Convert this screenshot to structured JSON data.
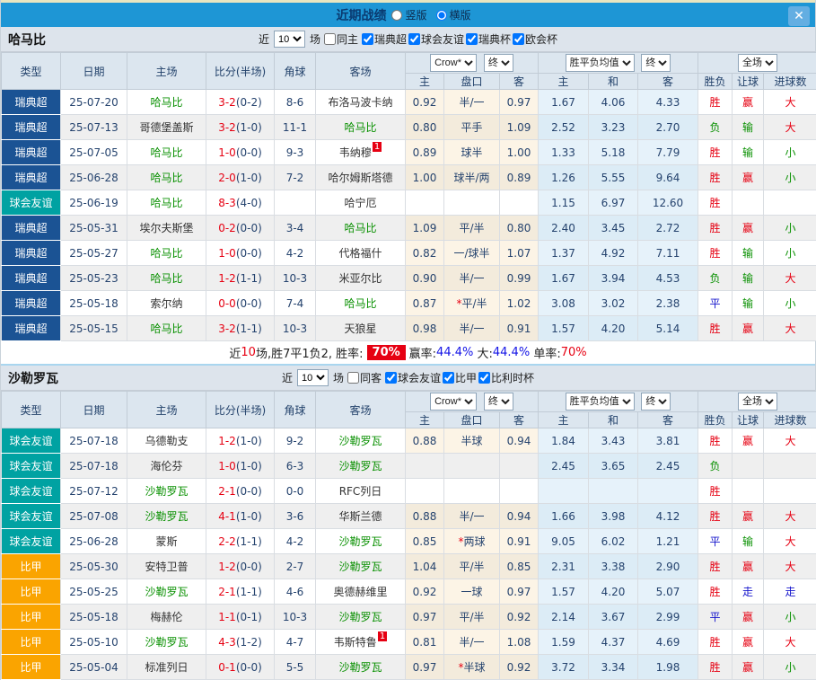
{
  "titlebar": {
    "title": "近期战绩",
    "radio_vertical": "竖版",
    "radio_horizontal": "横版",
    "close": "✕"
  },
  "columns": {
    "type": "类型",
    "date": "日期",
    "home": "主场",
    "score": "比分(半场)",
    "corner": "角球",
    "away": "客场",
    "h_home": "主",
    "h_handicap": "盘口",
    "h_away": "客",
    "m_home": "主",
    "m_draw": "和",
    "m_away": "客",
    "r_result": "胜负",
    "r_handicap": "让球",
    "r_goals": "进球数"
  },
  "selects": {
    "crow": "Crow*",
    "final1": "终",
    "mean": "胜平负均值",
    "final2": "终",
    "fullmatch": "全场"
  },
  "filter_words": {
    "near": "近",
    "games": "场"
  },
  "type_colors": {
    "瑞典超": "#1b5394",
    "球会友谊": "#00a2a2",
    "比甲": "#faa400"
  },
  "sections": [
    {
      "team": "哈马比",
      "filter": {
        "count": "10",
        "same": "同主",
        "leagues": [
          "瑞典超",
          "球会友谊",
          "瑞典杯",
          "欧会杯"
        ]
      },
      "rows": [
        {
          "type": "瑞典超",
          "date": "25-07-20",
          "home": "哈马比",
          "home_hl": true,
          "score": "3-2",
          "half": "(0-2)",
          "corner": "8-6",
          "away": "布洛马波卡纳",
          "away_hl": false,
          "odds": [
            "0.92",
            "半/一",
            "0.97"
          ],
          "mean": [
            "1.67",
            "4.06",
            "4.33"
          ],
          "res": [
            "胜",
            "赢",
            "大"
          ]
        },
        {
          "type": "瑞典超",
          "date": "25-07-13",
          "home": "哥德堡盖斯",
          "home_hl": false,
          "score": "3-2",
          "half": "(1-0)",
          "corner": "11-1",
          "away": "哈马比",
          "away_hl": true,
          "odds": [
            "0.80",
            "平手",
            "1.09"
          ],
          "mean": [
            "2.52",
            "3.23",
            "2.70"
          ],
          "res": [
            "负",
            "输",
            "大"
          ]
        },
        {
          "type": "瑞典超",
          "date": "25-07-05",
          "home": "哈马比",
          "home_hl": true,
          "score": "1-0",
          "half": "(0-0)",
          "corner": "9-3",
          "away": "韦纳穆",
          "away_hl": false,
          "away_badge": "1",
          "odds": [
            "0.89",
            "球半",
            "1.00"
          ],
          "mean": [
            "1.33",
            "5.18",
            "7.79"
          ],
          "res": [
            "胜",
            "输",
            "小"
          ]
        },
        {
          "type": "瑞典超",
          "date": "25-06-28",
          "home": "哈马比",
          "home_hl": true,
          "score": "2-0",
          "half": "(1-0)",
          "corner": "7-2",
          "away": "哈尔姆斯塔德",
          "away_hl": false,
          "odds": [
            "1.00",
            "球半/两",
            "0.89"
          ],
          "mean": [
            "1.26",
            "5.55",
            "9.64"
          ],
          "res": [
            "胜",
            "赢",
            "小"
          ]
        },
        {
          "type": "球会友谊",
          "date": "25-06-19",
          "home": "哈马比",
          "home_hl": true,
          "score": "8-3",
          "half": "(4-0)",
          "corner": "",
          "away": "哈宁厄",
          "away_hl": false,
          "odds": [
            "",
            "",
            ""
          ],
          "mean": [
            "1.15",
            "6.97",
            "12.60"
          ],
          "res": [
            "胜",
            "",
            ""
          ]
        },
        {
          "type": "瑞典超",
          "date": "25-05-31",
          "home": "埃尔夫斯堡",
          "home_hl": false,
          "score": "0-2",
          "half": "(0-0)",
          "corner": "3-4",
          "away": "哈马比",
          "away_hl": true,
          "odds": [
            "1.09",
            "平/半",
            "0.80"
          ],
          "mean": [
            "2.40",
            "3.45",
            "2.72"
          ],
          "res": [
            "胜",
            "赢",
            "小"
          ]
        },
        {
          "type": "瑞典超",
          "date": "25-05-27",
          "home": "哈马比",
          "home_hl": true,
          "score": "1-0",
          "half": "(0-0)",
          "corner": "4-2",
          "away": "代格福什",
          "away_hl": false,
          "odds": [
            "0.82",
            "一/球半",
            "1.07"
          ],
          "mean": [
            "1.37",
            "4.92",
            "7.11"
          ],
          "res": [
            "胜",
            "输",
            "小"
          ]
        },
        {
          "type": "瑞典超",
          "date": "25-05-23",
          "home": "哈马比",
          "home_hl": true,
          "score": "1-2",
          "half": "(1-1)",
          "corner": "10-3",
          "away": "米亚尔比",
          "away_hl": false,
          "odds": [
            "0.90",
            "半/一",
            "0.99"
          ],
          "mean": [
            "1.67",
            "3.94",
            "4.53"
          ],
          "res": [
            "负",
            "输",
            "大"
          ]
        },
        {
          "type": "瑞典超",
          "date": "25-05-18",
          "home": "索尔纳",
          "home_hl": false,
          "score": "0-0",
          "half": "(0-0)",
          "corner": "7-4",
          "away": "哈马比",
          "away_hl": true,
          "odds": [
            "0.87",
            "*平/半",
            "1.02"
          ],
          "mean": [
            "3.08",
            "3.02",
            "2.38"
          ],
          "res": [
            "平",
            "输",
            "小"
          ]
        },
        {
          "type": "瑞典超",
          "date": "25-05-15",
          "home": "哈马比",
          "home_hl": true,
          "score": "3-2",
          "half": "(1-1)",
          "corner": "10-3",
          "away": "天狼星",
          "away_hl": false,
          "odds": [
            "0.98",
            "半/一",
            "0.91"
          ],
          "mean": [
            "1.57",
            "4.20",
            "5.14"
          ],
          "res": [
            "胜",
            "赢",
            "大"
          ]
        }
      ],
      "summary": [
        {
          "t": "近",
          "s": "plain"
        },
        {
          "t": "10",
          "s": "red"
        },
        {
          "t": "场,胜7平1负2, 胜率:",
          "s": "plain"
        },
        {
          "t": "70%",
          "s": "badge"
        },
        {
          "t": "赢率:",
          "s": "plain"
        },
        {
          "t": "44.4%",
          "s": "blue"
        },
        {
          "t": " 大:",
          "s": "plain"
        },
        {
          "t": "44.4%",
          "s": "blue"
        },
        {
          "t": " 单率:",
          "s": "plain"
        },
        {
          "t": "70%",
          "s": "red"
        }
      ]
    },
    {
      "team": "沙勒罗瓦",
      "filter": {
        "count": "10",
        "same": "同客",
        "leagues": [
          "球会友谊",
          "比甲",
          "比利时杯"
        ]
      },
      "rows": [
        {
          "type": "球会友谊",
          "date": "25-07-18",
          "home": "乌德勒支",
          "home_hl": false,
          "score": "1-2",
          "half": "(1-0)",
          "corner": "9-2",
          "away": "沙勒罗瓦",
          "away_hl": true,
          "odds": [
            "0.88",
            "半球",
            "0.94"
          ],
          "mean": [
            "1.84",
            "3.43",
            "3.81"
          ],
          "res": [
            "胜",
            "赢",
            "大"
          ]
        },
        {
          "type": "球会友谊",
          "date": "25-07-18",
          "home": "海伦芬",
          "home_hl": false,
          "score": "1-0",
          "half": "(1-0)",
          "corner": "6-3",
          "away": "沙勒罗瓦",
          "away_hl": true,
          "odds": [
            "",
            "",
            ""
          ],
          "mean": [
            "2.45",
            "3.65",
            "2.45"
          ],
          "res": [
            "负",
            "",
            ""
          ]
        },
        {
          "type": "球会友谊",
          "date": "25-07-12",
          "home": "沙勒罗瓦",
          "home_hl": true,
          "score": "2-1",
          "half": "(0-0)",
          "corner": "0-0",
          "away": "RFC列日",
          "away_hl": false,
          "odds": [
            "",
            "",
            ""
          ],
          "mean": [
            "",
            "",
            ""
          ],
          "res": [
            "胜",
            "",
            ""
          ]
        },
        {
          "type": "球会友谊",
          "date": "25-07-08",
          "home": "沙勒罗瓦",
          "home_hl": true,
          "score": "4-1",
          "half": "(1-0)",
          "corner": "3-6",
          "away": "华斯兰德",
          "away_hl": false,
          "odds": [
            "0.88",
            "半/一",
            "0.94"
          ],
          "mean": [
            "1.66",
            "3.98",
            "4.12"
          ],
          "res": [
            "胜",
            "赢",
            "大"
          ]
        },
        {
          "type": "球会友谊",
          "date": "25-06-28",
          "home": "蒙斯",
          "home_hl": false,
          "score": "2-2",
          "half": "(1-1)",
          "corner": "4-2",
          "away": "沙勒罗瓦",
          "away_hl": true,
          "odds": [
            "0.85",
            "*两球",
            "0.91"
          ],
          "mean": [
            "9.05",
            "6.02",
            "1.21"
          ],
          "res": [
            "平",
            "输",
            "大"
          ]
        },
        {
          "type": "比甲",
          "date": "25-05-30",
          "home": "安特卫普",
          "home_hl": false,
          "score": "1-2",
          "half": "(0-0)",
          "corner": "2-7",
          "away": "沙勒罗瓦",
          "away_hl": true,
          "odds": [
            "1.04",
            "平/半",
            "0.85"
          ],
          "mean": [
            "2.31",
            "3.38",
            "2.90"
          ],
          "res": [
            "胜",
            "赢",
            "大"
          ]
        },
        {
          "type": "比甲",
          "date": "25-05-25",
          "home": "沙勒罗瓦",
          "home_hl": true,
          "score": "2-1",
          "half": "(1-1)",
          "corner": "4-6",
          "away": "奥德赫维里",
          "away_hl": false,
          "odds": [
            "0.92",
            "一球",
            "0.97"
          ],
          "mean": [
            "1.57",
            "4.20",
            "5.07"
          ],
          "res": [
            "胜",
            "走",
            "走"
          ]
        },
        {
          "type": "比甲",
          "date": "25-05-18",
          "home": "梅赫伦",
          "home_hl": false,
          "score": "1-1",
          "half": "(0-1)",
          "corner": "10-3",
          "away": "沙勒罗瓦",
          "away_hl": true,
          "odds": [
            "0.97",
            "平/半",
            "0.92"
          ],
          "mean": [
            "2.14",
            "3.67",
            "2.99"
          ],
          "res": [
            "平",
            "赢",
            "小"
          ]
        },
        {
          "type": "比甲",
          "date": "25-05-10",
          "home": "沙勒罗瓦",
          "home_hl": true,
          "score": "4-3",
          "half": "(1-2)",
          "corner": "4-7",
          "away": "韦斯特鲁",
          "away_hl": false,
          "away_badge": "1",
          "odds": [
            "0.81",
            "半/一",
            "1.08"
          ],
          "mean": [
            "1.59",
            "4.37",
            "4.69"
          ],
          "res": [
            "胜",
            "赢",
            "大"
          ]
        },
        {
          "type": "比甲",
          "date": "25-05-04",
          "home": "标准列日",
          "home_hl": false,
          "score": "0-1",
          "half": "(0-0)",
          "corner": "5-5",
          "away": "沙勒罗瓦",
          "away_hl": true,
          "odds": [
            "0.97",
            "*半球",
            "0.92"
          ],
          "mean": [
            "3.72",
            "3.34",
            "1.98"
          ],
          "res": [
            "胜",
            "赢",
            "小"
          ]
        }
      ],
      "summary": []
    }
  ]
}
